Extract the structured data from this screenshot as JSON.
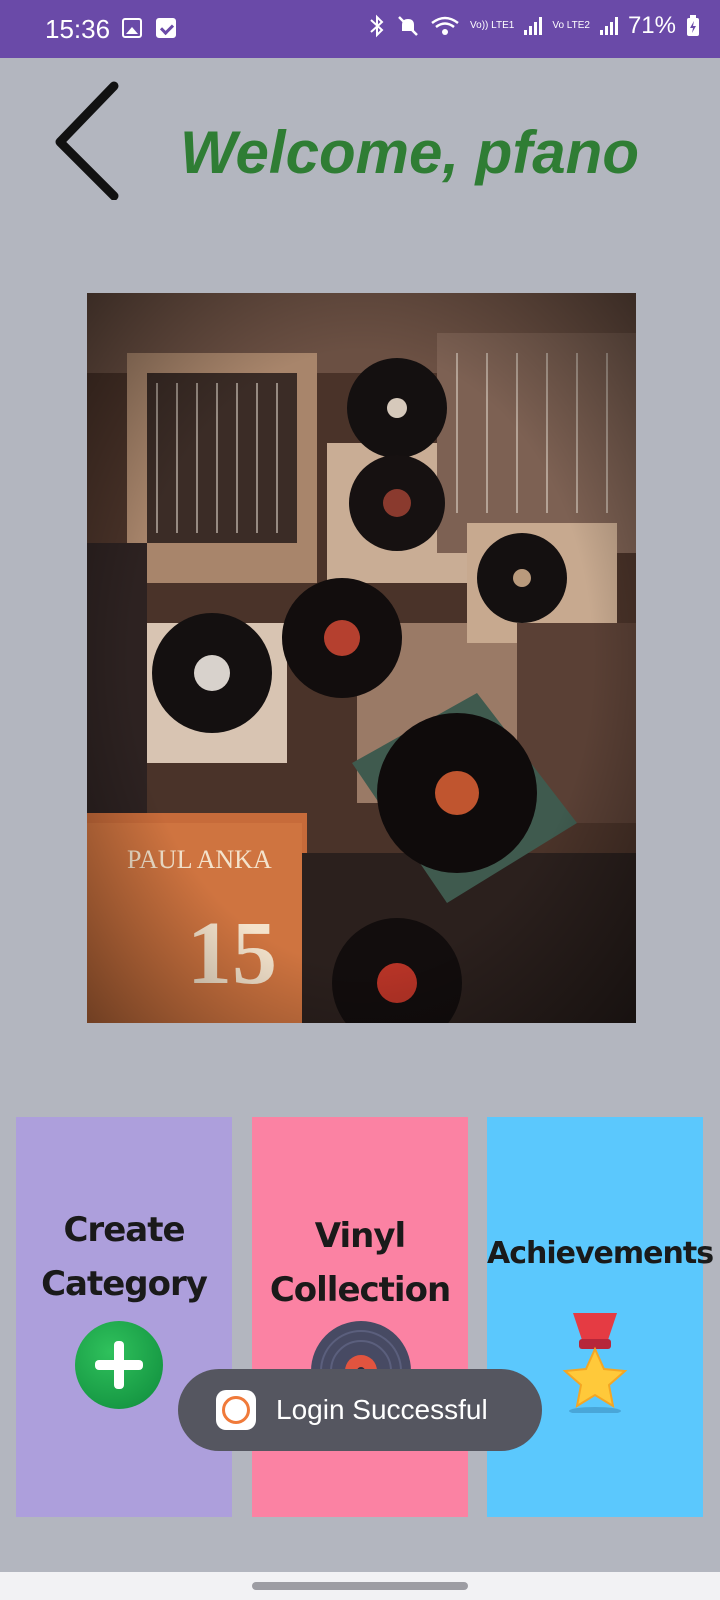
{
  "status_bar": {
    "time": "15:36",
    "battery": "71%",
    "network1": "Vo)) LTE1",
    "network2": "Vo LTE2",
    "left_icons": [
      "gallery-icon",
      "checkbox-icon"
    ],
    "right_icons": [
      "bluetooth-icon",
      "mute-icon",
      "wifi-icon",
      "signal-icon",
      "signal-icon",
      "battery-icon"
    ]
  },
  "header": {
    "welcome": "Welcome, pfano",
    "back_icon": "chevron-left-icon"
  },
  "hero": {
    "image_icon": "vinyl-records-photo"
  },
  "tiles": [
    {
      "label_line1": "Create",
      "label_line2": "Category",
      "icon": "plus-circle-icon",
      "color": "#ad9fdc"
    },
    {
      "label_line1": "Vinyl",
      "label_line2": "Collection",
      "icon": "vinyl-record-icon",
      "color": "#fb82a3"
    },
    {
      "label_line1": "Achievements",
      "label_line2": "",
      "icon": "medal-icon",
      "color": "#5bc8fd"
    }
  ],
  "toast": {
    "text": "Login Successful",
    "icon": "app-logo-icon"
  },
  "colors": {
    "status_bar": "#6a4aa8",
    "background": "#b3b6bf",
    "welcome": "#2f7d34"
  }
}
